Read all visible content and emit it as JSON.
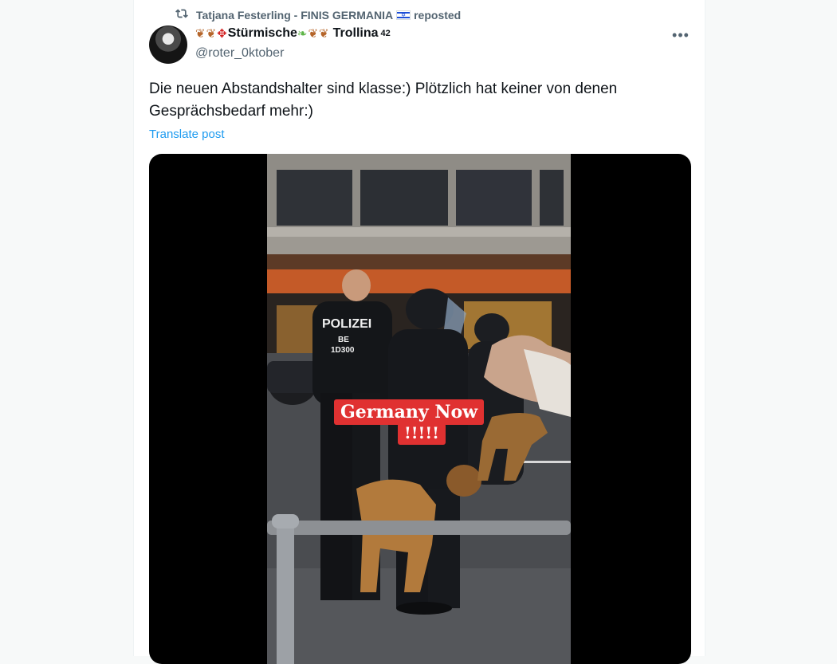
{
  "repost": {
    "icon": "repost-icon",
    "user": "Tatjana Festerling - FINIS GERMANIA",
    "flag": "israel-flag",
    "suffix": "reposted"
  },
  "author": {
    "name": "Stürmische",
    "name_tail": "Trollina",
    "superscript": "42",
    "handle": "@roter_0ktober"
  },
  "more_icon": "more-icon",
  "post": {
    "text": "Die neuen Abstandshalter sind klasse:) Plötzlich hat keiner von denen Gesprächsbedarf mehr:)",
    "translate_label": "Translate post"
  },
  "media": {
    "caption_line1": "Germany Now",
    "caption_line2": "!!!!!",
    "vest_label": "POLIZEI",
    "vest_code1": "BE",
    "vest_code2": "1D300"
  },
  "colors": {
    "link": "#1d9bf0",
    "secondary_text": "#536471",
    "caption_bg": "#e03131"
  }
}
